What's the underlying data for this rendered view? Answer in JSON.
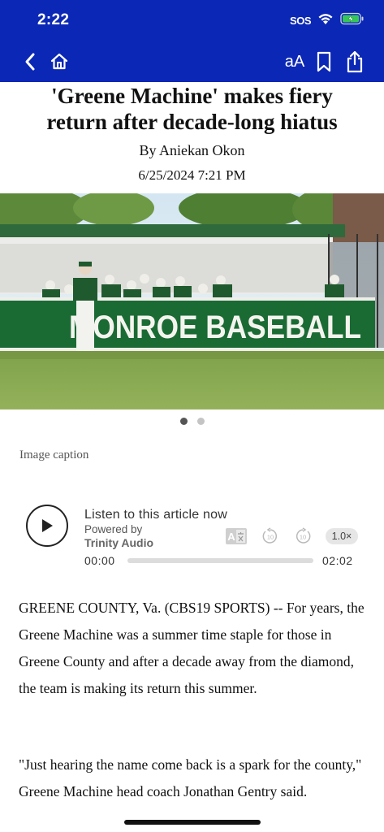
{
  "status_bar": {
    "time": "2:22",
    "sos": "SOS"
  },
  "nav": {
    "font_toggle_label": "aA"
  },
  "colors": {
    "header_bg": "#0b27b5",
    "battery": "#35c759"
  },
  "article": {
    "headline_line1": "'Greene Machine' makes fiery",
    "headline_line2": "return after decade-long hiatus",
    "byline": "By Aniekan Okon",
    "date": "6/25/2024 7:21 PM",
    "image_banner_text": "MONROE BASEBALL",
    "image_caption": "Image caption",
    "carousel": {
      "count": 2,
      "active_index": 0
    },
    "paragraphs": [
      "GREENE COUNTY, Va. (CBS19 SPORTS) -- For years, the Greene Machine was a summer time staple for those in Greene County and after a decade away from the diamond, the team is making its return this summer.",
      "\"Just hearing the name come back is a spark for the county,\" Greene Machine head coach Jonathan Gentry said."
    ]
  },
  "audio_player": {
    "listen_label": "Listen to this article now",
    "powered_by": "Powered by",
    "provider": "Trinity Audio",
    "rewind_label": "10",
    "forward_label": "10",
    "speed": "1.0×",
    "current_time": "00:00",
    "duration": "02:02",
    "progress": 0
  }
}
